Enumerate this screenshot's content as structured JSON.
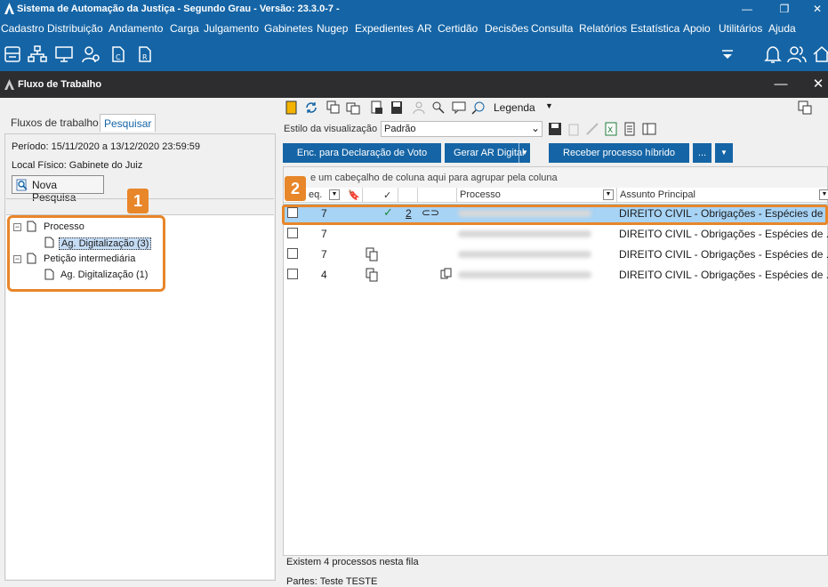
{
  "app": {
    "title": "Sistema de Automação da Justiça - Segundo Grau - Versão: 23.3.0-7 -",
    "minimize": "—",
    "restore": "❐",
    "close": "✕"
  },
  "menu": [
    "Cadastro",
    "Distribuição",
    "Andamento",
    "Carga",
    "Julgamento",
    "Gabinetes",
    "Nugep",
    "Expedientes",
    "AR",
    "Certidão",
    "Decisões",
    "Consulta",
    "Relatórios",
    "Estatística",
    "Apoio",
    "Utilitários",
    "Ajuda"
  ],
  "window": {
    "title": "Fluxo de Trabalho",
    "minimize": "—",
    "close": "✕"
  },
  "left": {
    "tabs": [
      "Fluxos de trabalho",
      "Pesquisar"
    ],
    "period": "Período: 15/11/2020 a 13/12/2020 23:59:59",
    "local": "Local Físico: Gabinete do Juiz",
    "search_button": "Nova Pesquisa",
    "tree": [
      {
        "label": "Processo",
        "child": "Ag. Digitalização (3)"
      },
      {
        "label": "Petição intermediária",
        "child": "Ag. Digitalização (1)"
      }
    ]
  },
  "right": {
    "legend": "Legenda",
    "style_label": "Estilo da visualização",
    "style_value": "Padrão",
    "buttons": [
      "Enc. para Declaração de Voto",
      "Gerar AR Digital",
      "Receber processo híbrido",
      "..."
    ],
    "group_hint": "e um cabeçalho de coluna aqui para agrupar pela coluna",
    "columns": {
      "seq": "eq.",
      "processo": "Processo",
      "assunto": "Assunto Principal"
    },
    "rows": [
      {
        "seq": "7",
        "count": "2",
        "assunto": "DIREITO CIVIL - Obrigações - Espécies de"
      },
      {
        "seq": "7",
        "assunto": "DIREITO CIVIL - Obrigações - Espécies de ..."
      },
      {
        "seq": "7",
        "assunto": "DIREITO CIVIL - Obrigações - Espécies de ..."
      },
      {
        "seq": "4",
        "assunto": "DIREITO CIVIL - Obrigações - Espécies de ..."
      }
    ],
    "footer_count": "Existem 4 processos nesta fila",
    "footer_partes": "Partes: Teste TESTE"
  },
  "badges": [
    "1",
    "2"
  ],
  "colors": {
    "brand": "#1565a6",
    "highlight": "#e8862a",
    "selected_row": "#a7d3f5"
  }
}
